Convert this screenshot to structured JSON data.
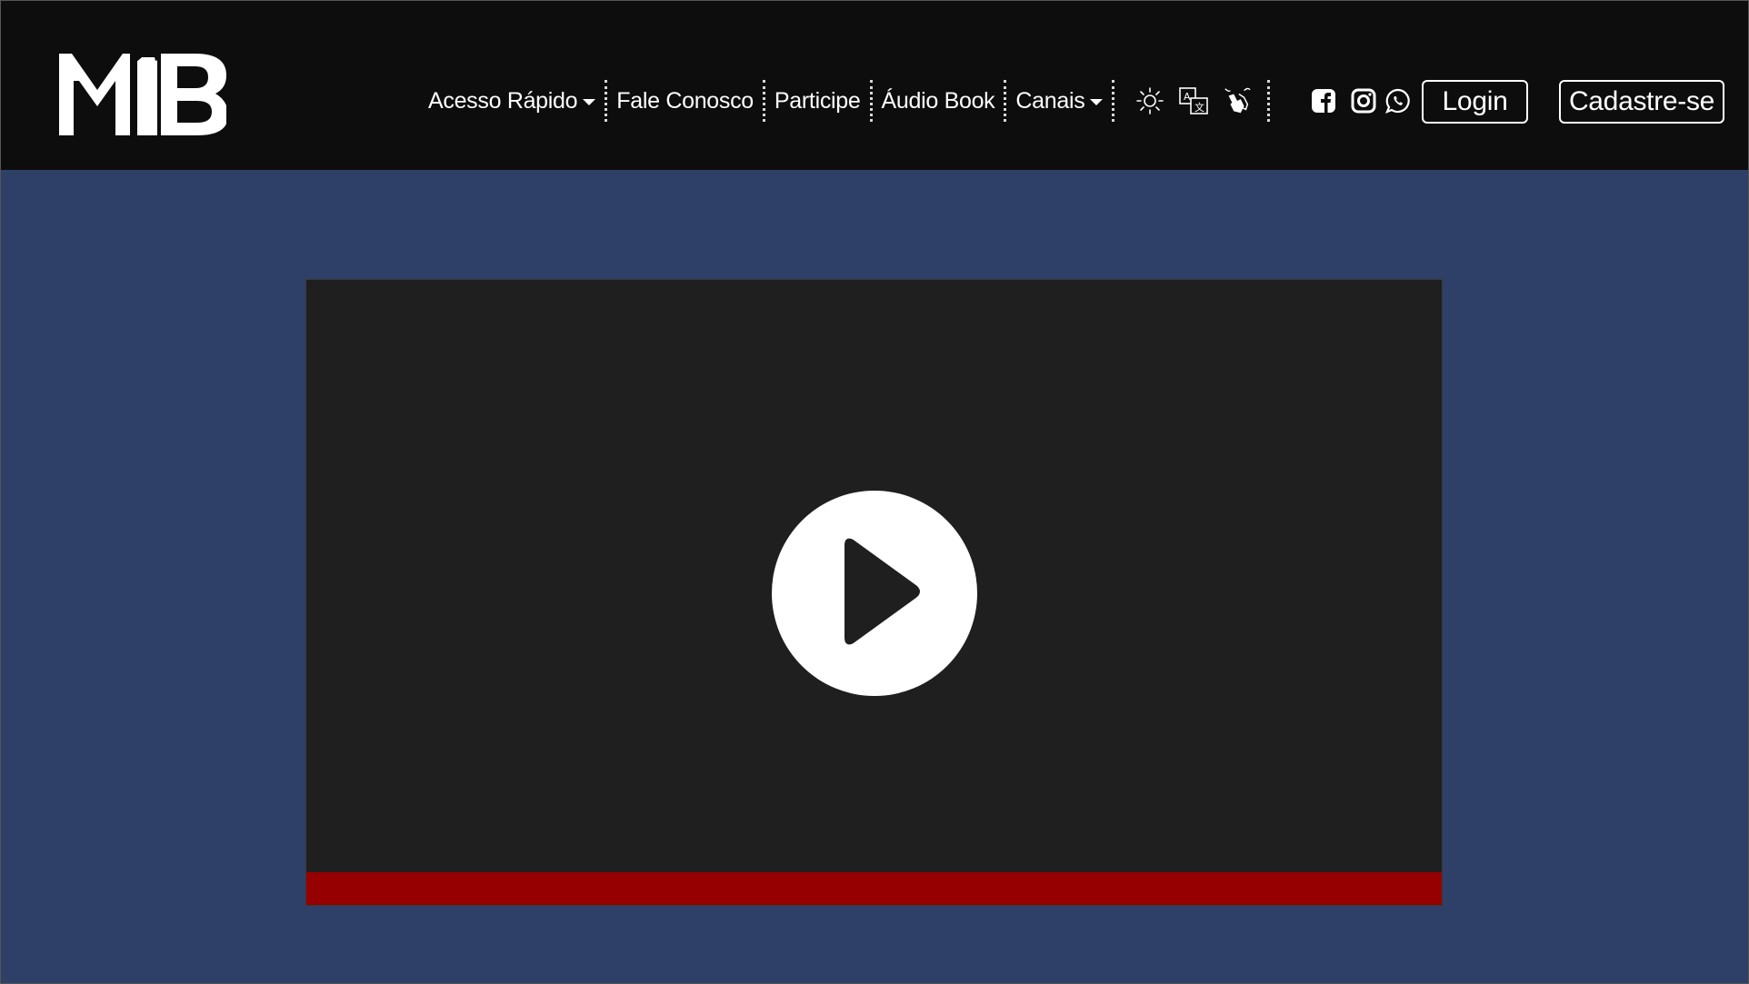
{
  "logo": {
    "text": "MIB",
    "icon": "mib-logo"
  },
  "nav": {
    "items": [
      {
        "label": "Acesso Rápido",
        "has_dropdown": true
      },
      {
        "label": "Fale Conosco",
        "has_dropdown": false
      },
      {
        "label": "Participe",
        "has_dropdown": false
      },
      {
        "label": "Áudio Book",
        "has_dropdown": false
      },
      {
        "label": "Canais",
        "has_dropdown": true
      }
    ],
    "tools": [
      "brightness-icon",
      "translate-icon",
      "sign-language-icon"
    ],
    "social": [
      "facebook-icon",
      "instagram-icon",
      "whatsapp-icon"
    ]
  },
  "auth": {
    "login_label": "Login",
    "signup_label": "Cadastre-se"
  },
  "video": {
    "play_icon": "play-icon",
    "progress_color": "#960000"
  },
  "colors": {
    "header_bg": "#0d0d0d",
    "page_bg": "#2e4068",
    "video_bg": "#201f20",
    "accent": "#960000"
  }
}
